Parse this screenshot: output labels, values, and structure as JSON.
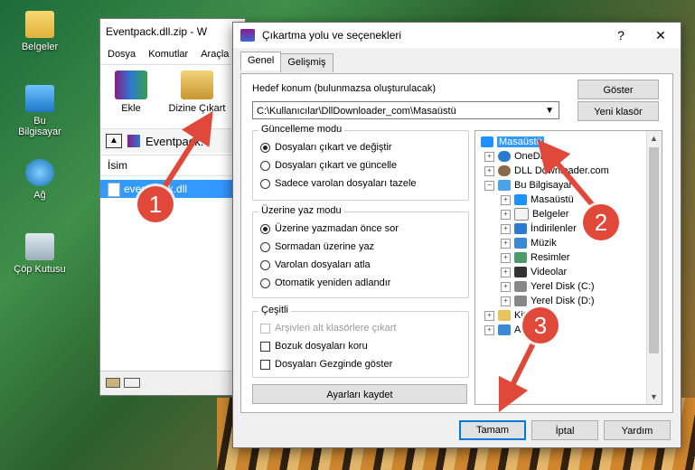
{
  "desktop": {
    "icons": [
      {
        "label": "Belgeler",
        "icon": "folder-icon"
      },
      {
        "label": "Bu Bilgisayar",
        "icon": "computer-icon"
      },
      {
        "label": "Ağ",
        "icon": "network-icon"
      },
      {
        "label": "Çöp Kutusu",
        "icon": "recycle-bin-icon"
      }
    ]
  },
  "winrar": {
    "title": "Eventpack.dll.zip - W",
    "menu": [
      "Dosya",
      "Komutlar",
      "Araçla"
    ],
    "toolbar": {
      "add": "Ekle",
      "extract": "Dizine Çıkart"
    },
    "path": "Eventpack.",
    "list_header": "İsim",
    "file": "eventpack.dll"
  },
  "dialog": {
    "title": "Çıkartma yolu ve seçenekleri",
    "help_btn": "?",
    "close_btn": "✕",
    "tabs": [
      "Genel",
      "Gelişmiş"
    ],
    "dest_label": "Hedef konum (bulunmazsa oluşturulacak)",
    "dest_value": "C:\\Kullanıcılar\\DllDownloader_com\\Masaüstü",
    "show_btn": "Göster",
    "new_folder_btn": "Yeni klasör",
    "update_mode": {
      "title": "Güncelleme modu",
      "options": [
        "Dosyaları çıkart ve değiştir",
        "Dosyaları çıkart ve güncelle",
        "Sadece varolan dosyaları tazele"
      ],
      "selected": 0
    },
    "overwrite_mode": {
      "title": "Üzerine yaz modu",
      "options": [
        "Üzerine yazmadan önce sor",
        "Sormadan üzerine yaz",
        "Varolan dosyaları atla",
        "Otomatik yeniden adlandır"
      ],
      "selected": 0
    },
    "misc": {
      "title": "Çeşitli",
      "options": [
        "Arşivleri alt klasörlere çıkart",
        "Bozuk dosyaları koru",
        "Dosyaları Gezginde göster"
      ]
    },
    "save_btn": "Ayarları kaydet",
    "tree": [
      {
        "label": "Masaüstü",
        "selected": true,
        "level": 0
      },
      {
        "label": "OneDr",
        "level": 1
      },
      {
        "label": "DLL Downloader.com",
        "level": 1
      },
      {
        "label": "Bu Bilgisayar",
        "level": 1
      },
      {
        "label": "Masaüstü",
        "level": 2
      },
      {
        "label": "Belgeler",
        "level": 2
      },
      {
        "label": "İndirilenler",
        "level": 2
      },
      {
        "label": "Müzik",
        "level": 2
      },
      {
        "label": "Resimler",
        "level": 2
      },
      {
        "label": "Videolar",
        "level": 2
      },
      {
        "label": "Yerel Disk (C:)",
        "level": 2
      },
      {
        "label": "Yerel Disk (D:)",
        "level": 2
      },
      {
        "label": "Kitapl",
        "level": 1
      },
      {
        "label": "Ağ",
        "level": 1
      }
    ],
    "ok_btn": "Tamam",
    "cancel_btn": "İptal",
    "help_bottom_btn": "Yardım"
  },
  "annotations": [
    "1",
    "2",
    "3"
  ]
}
